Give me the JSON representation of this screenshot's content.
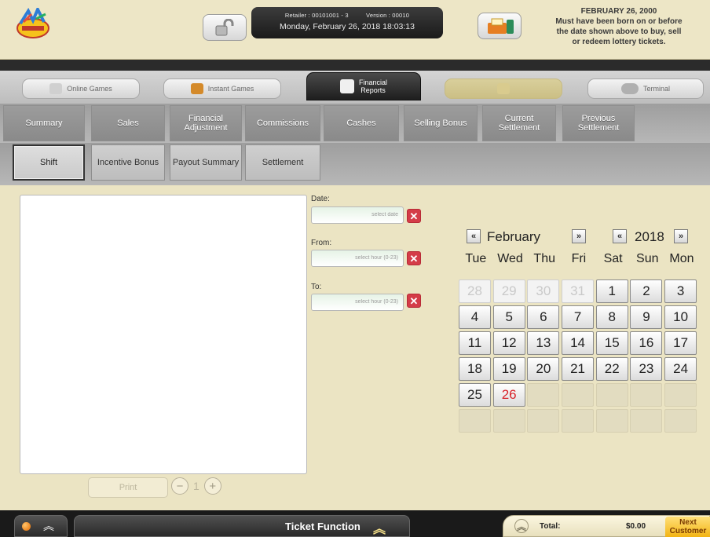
{
  "header": {
    "retailer_label": "Retailer : 00101001 - 3",
    "version_label": "Version : 00010",
    "datetime": "Monday, February 26, 2018 18:03:13",
    "notice_date": "FEBRUARY 26, 2000",
    "notice_line1": "Must have been born on or before",
    "notice_line2": "the date shown above to buy, sell",
    "notice_line3": "or redeem lottery tickets."
  },
  "main_tabs": {
    "online_games": "Online Games",
    "instant_games": "Instant Games",
    "financial_line1": "Financial",
    "financial_line2": "Reports",
    "terminal": "Terminal"
  },
  "subtabs": {
    "row1": [
      "Summary",
      "Sales",
      "Financial Adjustment",
      "Commissions",
      "Cashes",
      "Selling Bonus",
      "Current Settlement",
      "Previous Settlement"
    ],
    "row2": [
      "Shift",
      "Incentive Bonus",
      "Payout Summary",
      "Settlement"
    ]
  },
  "filters": {
    "date_label": "Date:",
    "date_placeholder": "select date",
    "from_label": "From:",
    "from_placeholder": "select hour (0-23)",
    "to_label": "To:",
    "to_placeholder": "select hour (0-23)",
    "clear_symbol": "✕"
  },
  "report": {
    "print_label": "Print",
    "page_number": "1",
    "minus": "−",
    "plus": "+"
  },
  "calendar": {
    "month": "February",
    "year": "2018",
    "prev": "«",
    "next": "»",
    "weekdays": [
      "Tue",
      "Wed",
      "Thu",
      "Fri",
      "Sat",
      "Sun",
      "Mon"
    ],
    "days": [
      {
        "d": "28",
        "s": "other"
      },
      {
        "d": "29",
        "s": "other"
      },
      {
        "d": "30",
        "s": "other"
      },
      {
        "d": "31",
        "s": "other"
      },
      {
        "d": "1",
        "s": ""
      },
      {
        "d": "2",
        "s": ""
      },
      {
        "d": "3",
        "s": ""
      },
      {
        "d": "4",
        "s": ""
      },
      {
        "d": "5",
        "s": ""
      },
      {
        "d": "6",
        "s": ""
      },
      {
        "d": "7",
        "s": ""
      },
      {
        "d": "8",
        "s": ""
      },
      {
        "d": "9",
        "s": ""
      },
      {
        "d": "10",
        "s": ""
      },
      {
        "d": "11",
        "s": ""
      },
      {
        "d": "12",
        "s": ""
      },
      {
        "d": "13",
        "s": ""
      },
      {
        "d": "14",
        "s": ""
      },
      {
        "d": "15",
        "s": ""
      },
      {
        "d": "16",
        "s": ""
      },
      {
        "d": "17",
        "s": ""
      },
      {
        "d": "18",
        "s": ""
      },
      {
        "d": "19",
        "s": ""
      },
      {
        "d": "20",
        "s": ""
      },
      {
        "d": "21",
        "s": ""
      },
      {
        "d": "22",
        "s": ""
      },
      {
        "d": "23",
        "s": ""
      },
      {
        "d": "24",
        "s": ""
      },
      {
        "d": "25",
        "s": ""
      },
      {
        "d": "26",
        "s": "today"
      },
      {
        "d": "",
        "s": "empty"
      },
      {
        "d": "",
        "s": "empty"
      },
      {
        "d": "",
        "s": "empty"
      },
      {
        "d": "",
        "s": "empty"
      },
      {
        "d": "",
        "s": "empty"
      },
      {
        "d": "",
        "s": "empty"
      },
      {
        "d": "",
        "s": "empty"
      },
      {
        "d": "",
        "s": "empty"
      },
      {
        "d": "",
        "s": "empty"
      },
      {
        "d": "",
        "s": "empty"
      },
      {
        "d": "",
        "s": "empty"
      },
      {
        "d": "",
        "s": "empty"
      }
    ]
  },
  "footer": {
    "ticket_function": "Ticket Function",
    "total_label": "Total:",
    "total_value": "$0.00",
    "next_line1": "Next",
    "next_line2": "Customer"
  },
  "colors": {
    "today": "#d8232a",
    "clear_button": "#d43c48",
    "next_button": "#f3b413"
  },
  "icons": {
    "logo": "lottery-logo",
    "lock": "unlock-icon",
    "printer": "printer-icon",
    "chevron": "double-chevron-up-icon"
  }
}
